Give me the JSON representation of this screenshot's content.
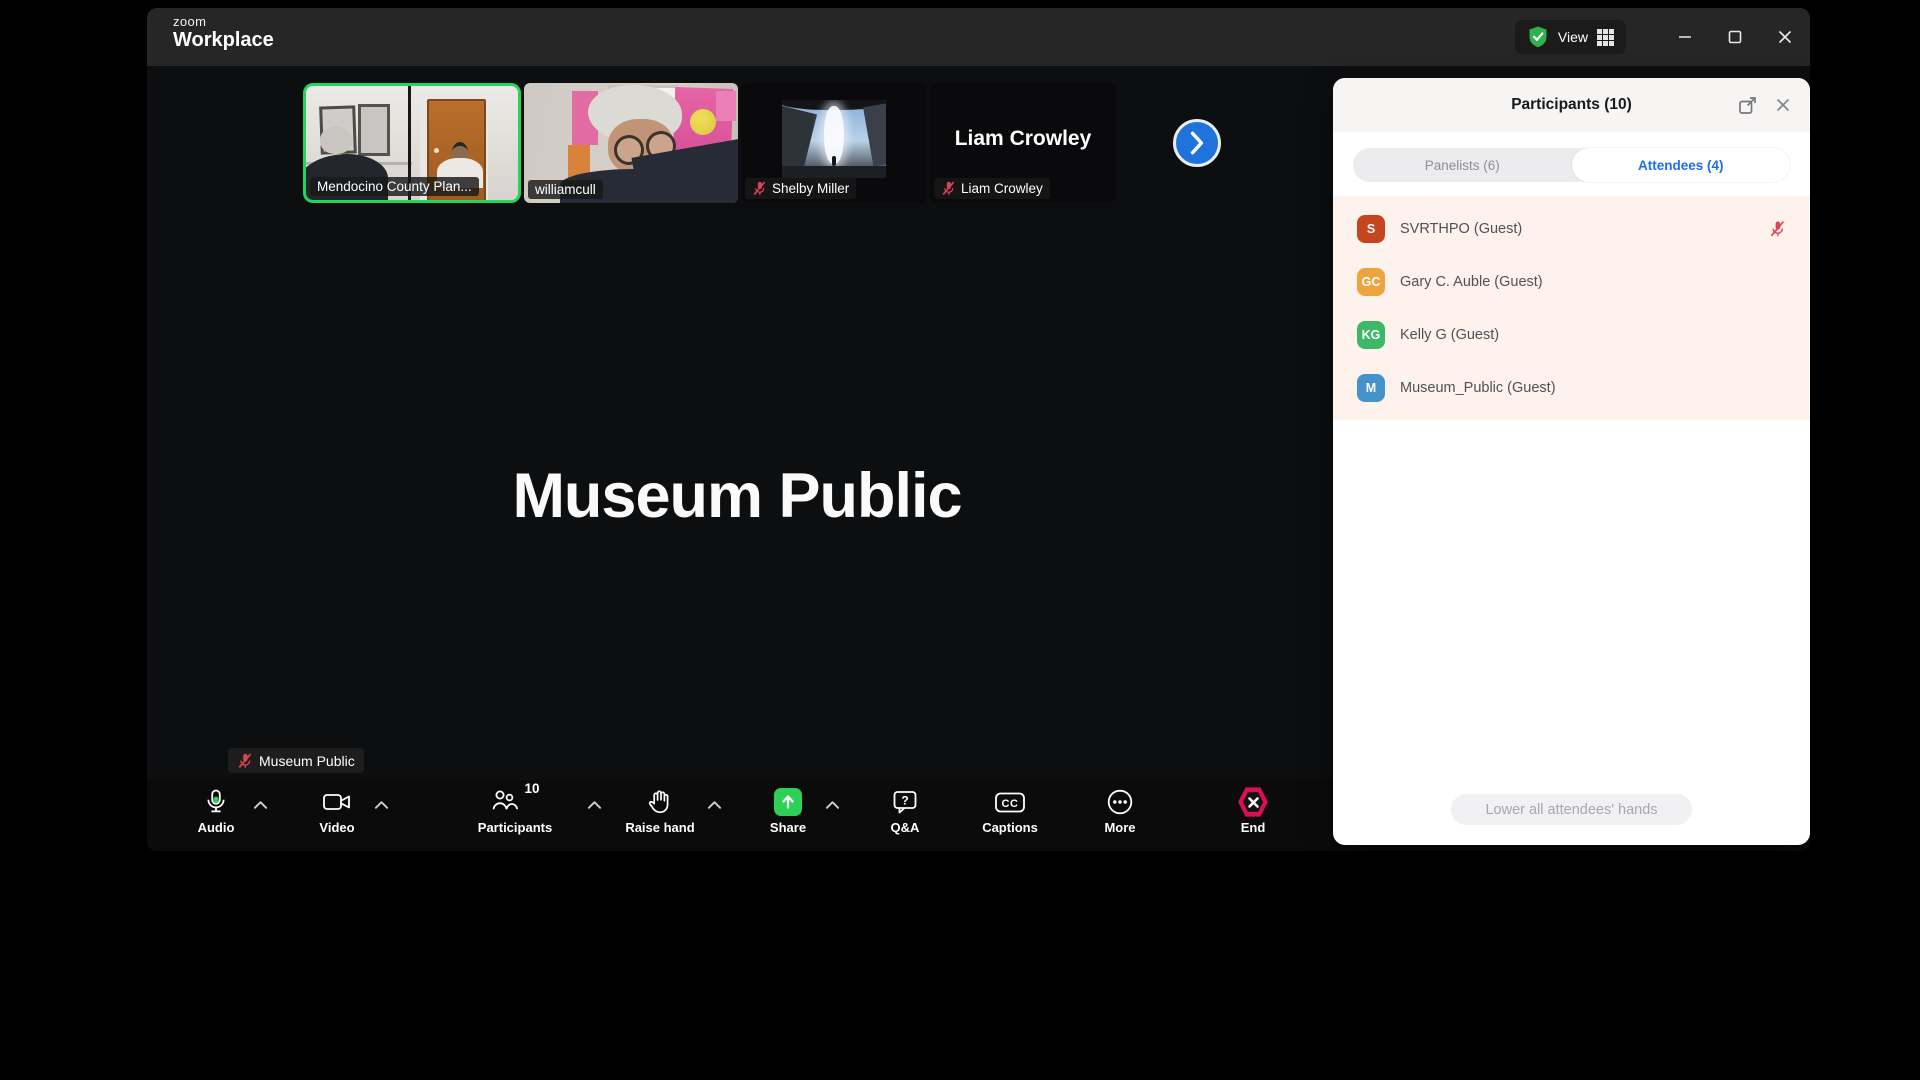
{
  "titlebar": {
    "brand_top": "zoom",
    "brand_bottom": "Workplace",
    "view_label": "View"
  },
  "filmstrip": {
    "tiles": [
      {
        "label": "Mendocino County Plan...",
        "muted": false,
        "active_speaker": true
      },
      {
        "label": "williamcull",
        "muted": false
      },
      {
        "label": "Shelby Miller",
        "muted": true
      },
      {
        "label": "Liam Crowley",
        "display_name": "Liam Crowley",
        "muted": true
      }
    ]
  },
  "stage": {
    "display_name": "Museum Public",
    "speaker_label": "Museum Public"
  },
  "toolbar": {
    "audio": {
      "label": "Audio"
    },
    "video": {
      "label": "Video"
    },
    "participants": {
      "label": "Participants",
      "count": "10"
    },
    "raise_hand": {
      "label": "Raise hand"
    },
    "share": {
      "label": "Share"
    },
    "qa": {
      "label": "Q&A"
    },
    "captions": {
      "label": "Captions"
    },
    "more": {
      "label": "More"
    },
    "end": {
      "label": "End"
    }
  },
  "panel": {
    "title": "Participants (10)",
    "tabs": {
      "panelists": "Panelists (6)",
      "attendees": "Attendees (4)"
    },
    "attendees": [
      {
        "initials": "S",
        "name": "SVRTHPO (Guest)",
        "color": "#c5451f",
        "muted": true
      },
      {
        "initials": "GC",
        "name": "Gary C. Auble (Guest)",
        "color": "#eda43c",
        "muted": false
      },
      {
        "initials": "KG",
        "name": "Kelly G (Guest)",
        "color": "#3db768",
        "muted": false
      },
      {
        "initials": "M",
        "name": "Museum_Public (Guest)",
        "color": "#4692ca",
        "muted": false
      }
    ],
    "footer_button": "Lower all attendees' hands"
  },
  "colors": {
    "accent_green": "#2ed158",
    "end_red": "#da1050",
    "next_blue": "#2173dc",
    "attendee_section_bg": "#fdf2ec",
    "active_tab_text": "#1d6fe8"
  }
}
